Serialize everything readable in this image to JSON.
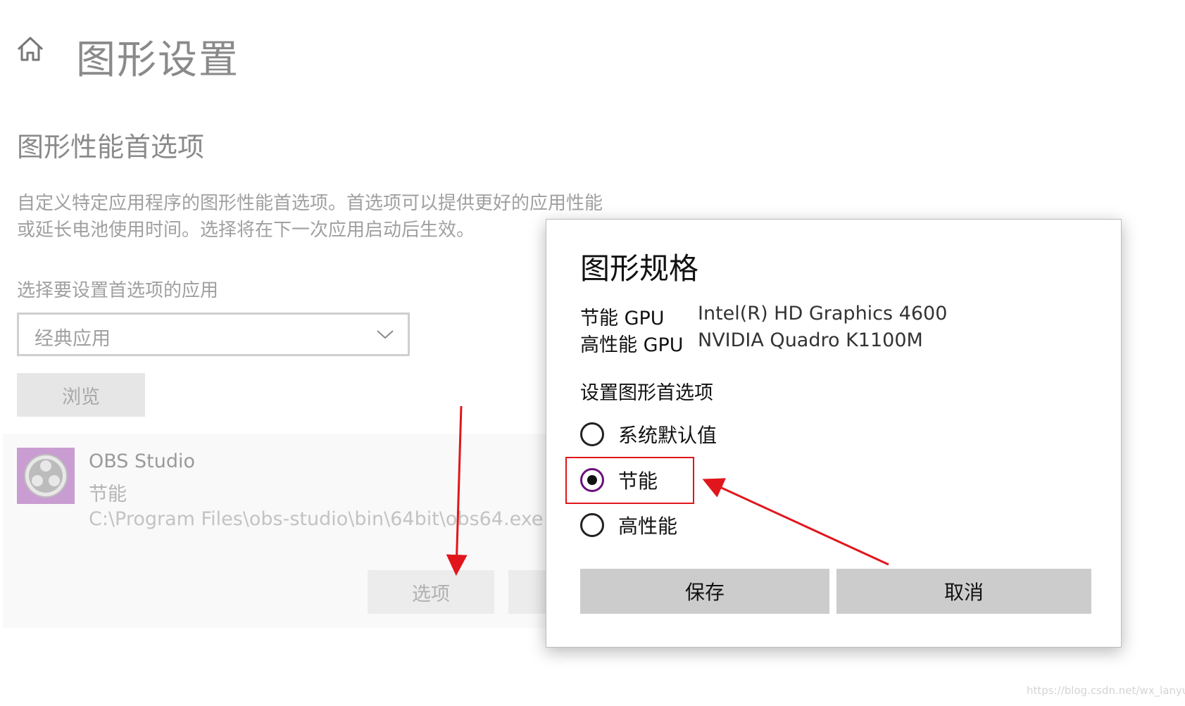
{
  "page": {
    "title": "图形设置",
    "section_title": "图形性能首选项",
    "description_line1": "自定义特定应用程序的图形性能首选项。首选项可以提供更好的应用性能",
    "description_line2": "或延长电池使用时间。选择将在下一次应用启动后生效。",
    "choose_label": "选择要设置首选项的应用",
    "dropdown_value": "经典应用",
    "browse_label": "浏览",
    "app": {
      "name": "OBS Studio",
      "mode": "节能",
      "path": "C:\\Program Files\\obs-studio\\bin\\64bit\\obs64.exe",
      "options_label": "选项"
    }
  },
  "dialog": {
    "title": "图形规格",
    "power_saving_gpu_label": "节能 GPU",
    "power_saving_gpu_value": "Intel(R) HD Graphics 4600",
    "high_perf_gpu_label": "高性能 GPU",
    "high_perf_gpu_value": "NVIDIA Quadro K1100M",
    "preference_label": "设置图形首选项",
    "options": [
      {
        "label": "系统默认值",
        "selected": false
      },
      {
        "label": "节能",
        "selected": true
      },
      {
        "label": "高性能",
        "selected": false
      }
    ],
    "save_label": "保存",
    "cancel_label": "取消"
  },
  "watermark": "https://blog.csdn.net/wx_lanyu",
  "colors": {
    "annotation_red": "#e0161c",
    "dialog_button_bg": "#cccccc",
    "radio_selected_ring": "#6b0f7a"
  },
  "icons": [
    "home-icon",
    "chevron-down-icon",
    "obs-logo-icon"
  ]
}
